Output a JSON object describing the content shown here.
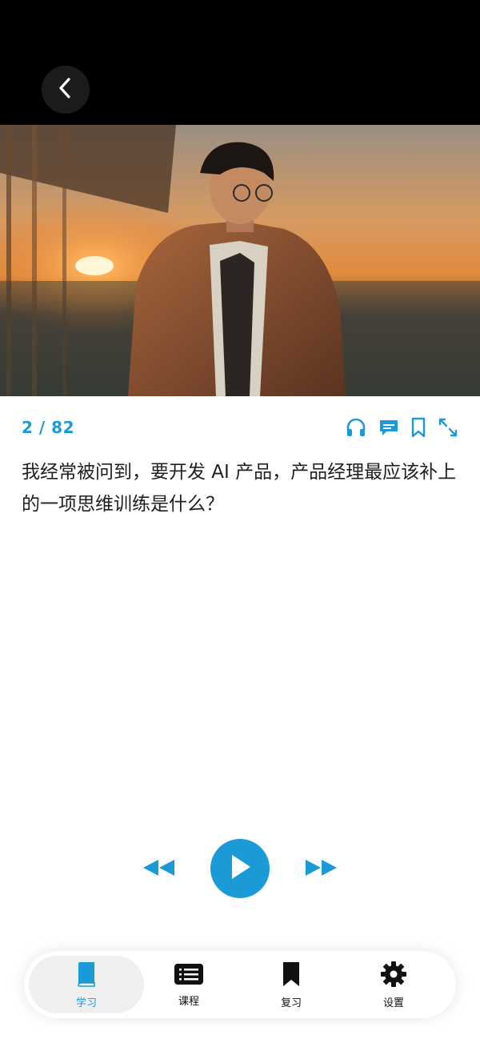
{
  "nav": {
    "back_icon": "chevron-left-icon"
  },
  "hero": {
    "image": "man-in-coat-sunset-photo"
  },
  "card": {
    "progress": "2 / 82",
    "question": "我经常被问到，要开发 AI 产品，产品经理最应该补上的一项思维训练是什么？",
    "actions": [
      "headphones-icon",
      "comment-icon",
      "bookmark-icon",
      "expand-icon"
    ]
  },
  "player": {
    "rewind_icon": "rewind-icon",
    "play_icon": "play-icon",
    "forward_icon": "fast-forward-icon"
  },
  "tabs": [
    {
      "label": "学习",
      "icon": "book-icon",
      "active": true
    },
    {
      "label": "课程",
      "icon": "list-icon",
      "active": false
    },
    {
      "label": "复习",
      "icon": "bookmark-icon",
      "active": false
    },
    {
      "label": "设置",
      "icon": "gear-icon",
      "active": false
    }
  ],
  "colors": {
    "accent": "#1a9bd7",
    "text": "#1f1f1f",
    "topbar": "#000000"
  }
}
